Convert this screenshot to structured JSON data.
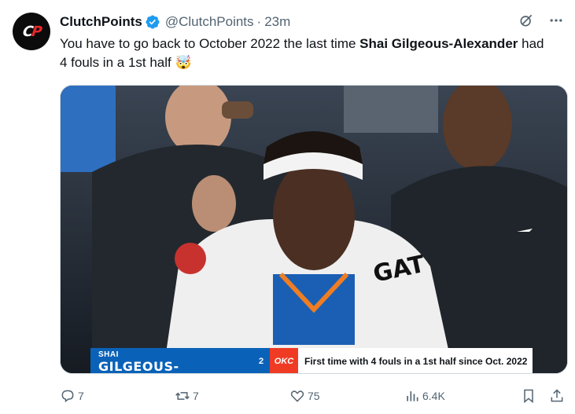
{
  "author": {
    "display_name": "ClutchPoints",
    "handle": "@ClutchPoints",
    "separator": "·",
    "time": "23m",
    "avatar_text": "CP",
    "verified": true
  },
  "tweet": {
    "text_before": "You have to go back to October 2022 the last time ",
    "text_bold": "Shai Gilgeous-Alexander",
    "text_after": " had 4 fouls in a 1st half ",
    "emoji": "🤯"
  },
  "media": {
    "lower_third": {
      "first_name": "SHAI",
      "last_name": "GILGEOUS-ALEXANDER",
      "jersey_number": "2",
      "team_logo": "OKC",
      "caption": "First time with 4 fouls in a 1st half since Oct. 2022"
    }
  },
  "actions": {
    "replies": "7",
    "reposts": "7",
    "likes": "75",
    "views": "6.4K"
  },
  "icons": {
    "verified": "verified-badge-icon",
    "grok": "grok-icon",
    "more": "more-icon",
    "reply": "reply-icon",
    "repost": "repost-icon",
    "like": "like-icon",
    "views": "views-icon",
    "bookmark": "bookmark-icon",
    "share": "share-icon"
  },
  "colors": {
    "verified_blue": "#1d9bf0",
    "muted_text": "#536471",
    "okc_blue": "#0a62b8",
    "okc_orange": "#ef3b24"
  }
}
